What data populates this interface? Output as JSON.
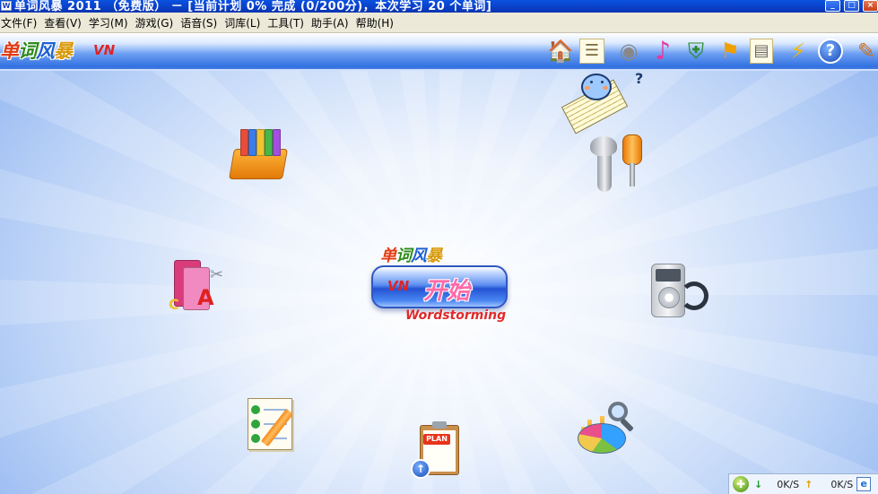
{
  "window": {
    "title": "单词风暴 2011 （免费版） － [当前计划 0% 完成 (0/200分)，本次学习 20 个单词]",
    "min_glyph": "_",
    "max_glyph": "□",
    "close_glyph": "×",
    "app_icon_glyph": "W"
  },
  "menu": {
    "items": [
      {
        "label": "文件(F)"
      },
      {
        "label": "查看(V)"
      },
      {
        "label": "学习(M)"
      },
      {
        "label": "游戏(G)"
      },
      {
        "label": "语音(S)"
      },
      {
        "label": "词库(L)"
      },
      {
        "label": "工具(T)"
      },
      {
        "label": "助手(A)"
      },
      {
        "label": "帮助(H)"
      }
    ]
  },
  "toolbar": {
    "logo": [
      "单",
      "词",
      "风",
      "暴"
    ],
    "brand_mark": "VN",
    "icons": [
      {
        "name": "home-icon",
        "glyph": "🏠"
      },
      {
        "name": "word-list-icon",
        "glyph": "☰"
      },
      {
        "name": "speaker-icon",
        "glyph": "◉"
      },
      {
        "name": "music-icon",
        "glyph": "♪"
      },
      {
        "name": "shield-icon",
        "glyph": "⛨"
      },
      {
        "name": "assistant-icon",
        "glyph": "⚑"
      },
      {
        "name": "notes-icon",
        "glyph": "▤"
      },
      {
        "name": "network-icon",
        "glyph": "⚡"
      },
      {
        "name": "help-icon",
        "glyph": "?"
      },
      {
        "name": "palette-icon",
        "glyph": "✎"
      }
    ]
  },
  "center": {
    "small_logo": [
      "单",
      "词",
      "风",
      "暴"
    ],
    "start_mark": "VN",
    "start_label": "开始",
    "brand_en": "Wordstorming"
  },
  "mascot": {
    "question_mark": "?"
  },
  "plan": {
    "tag": "PLAN",
    "upload_glyph": "↑"
  },
  "status_bar": {
    "green_button_glyph": "✚",
    "down_arrow": "↓",
    "down_speed": "0K/S",
    "up_arrow": "↑",
    "up_speed": "0K/S",
    "ie_glyph": "e"
  },
  "colors": {
    "title_blue": "#0a52e0",
    "toolbar_blue": "#2f6fe0",
    "accent_red": "#e03b12",
    "accent_green": "#2d8a1c"
  }
}
